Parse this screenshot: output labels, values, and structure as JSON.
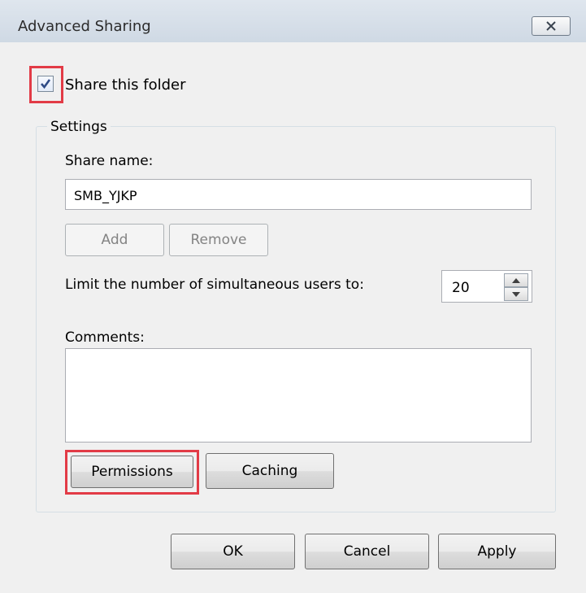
{
  "window": {
    "title": "Advanced Sharing"
  },
  "share_folder": {
    "label": "Share this folder",
    "checked": true
  },
  "settings": {
    "group_label": "Settings",
    "share_name_label": "Share name:",
    "share_name_value": "SMB_YJKP",
    "add_button": "Add",
    "remove_button": "Remove",
    "limit_label": "Limit the number of simultaneous users to:",
    "limit_value": "20",
    "comments_label": "Comments:",
    "comments_value": "",
    "permissions_button": "Permissions",
    "caching_button": "Caching"
  },
  "footer": {
    "ok": "OK",
    "cancel": "Cancel",
    "apply": "Apply"
  },
  "highlight_color": "#e23b46"
}
